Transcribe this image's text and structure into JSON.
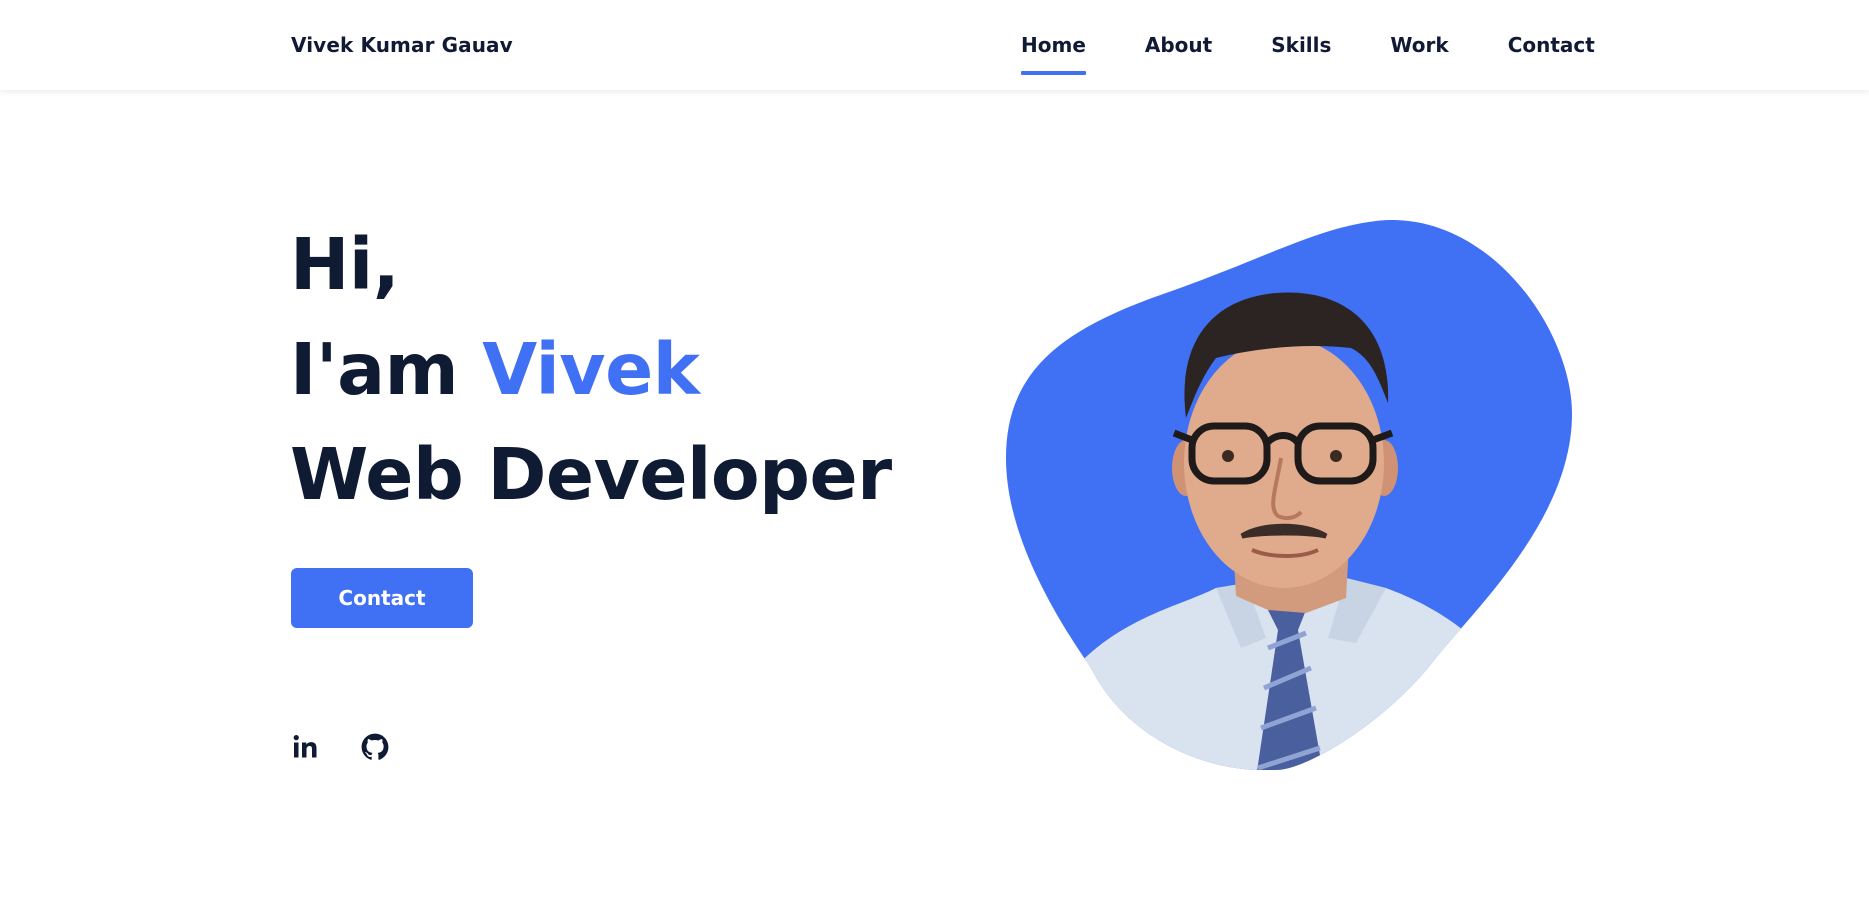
{
  "header": {
    "logo": "Vivek Kumar Gauav",
    "nav": [
      {
        "label": "Home",
        "active": true
      },
      {
        "label": "About",
        "active": false
      },
      {
        "label": "Skills",
        "active": false
      },
      {
        "label": "Work",
        "active": false
      },
      {
        "label": "Contact",
        "active": false
      }
    ]
  },
  "hero": {
    "line1": "Hi,",
    "line2_prefix": "I'am ",
    "line2_name": "Vivek",
    "line3": "Web Developer",
    "button_label": "Contact"
  },
  "socials": [
    {
      "icon": "linkedin-icon",
      "label": "in"
    },
    {
      "icon": "github-icon"
    }
  ],
  "colors": {
    "accent": "#4070f4",
    "text": "#0f1a33",
    "background": "#ffffff"
  }
}
